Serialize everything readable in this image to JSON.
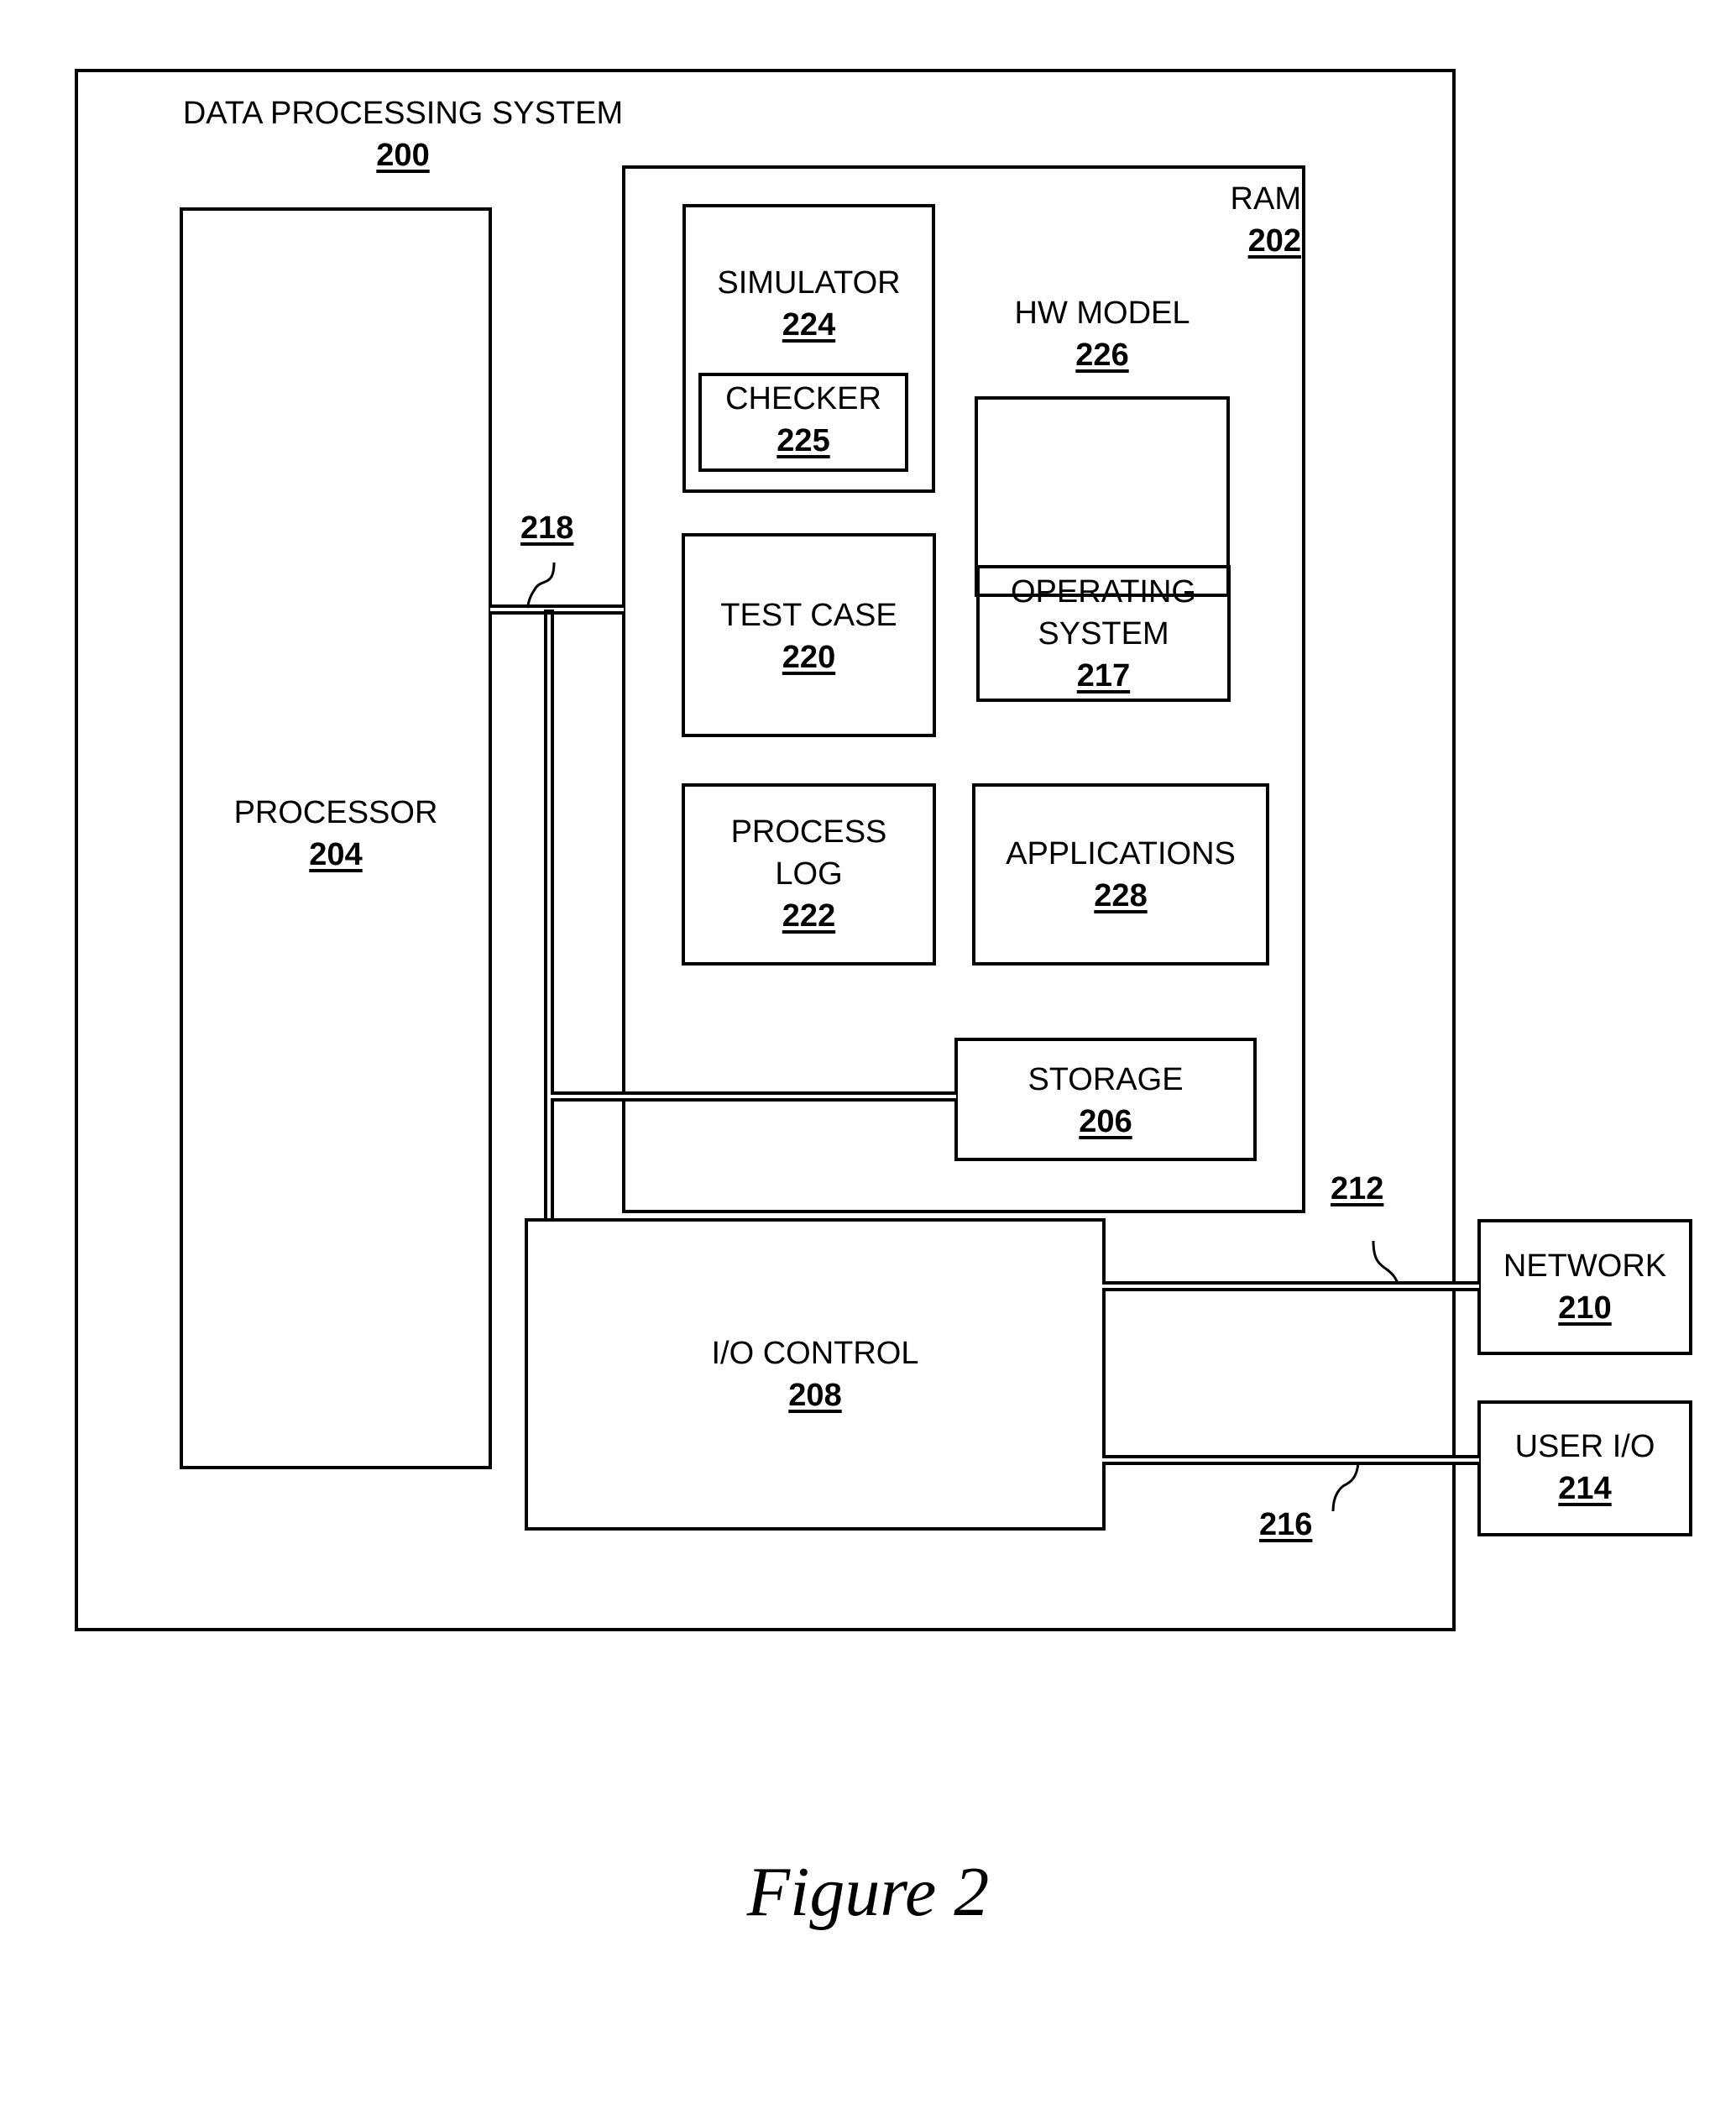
{
  "system": {
    "title": "DATA PROCESSING SYSTEM",
    "ref": "200"
  },
  "ram": {
    "title": "RAM",
    "ref": "202"
  },
  "processor": {
    "title": "PROCESSOR",
    "ref": "204"
  },
  "storage": {
    "title": "STORAGE",
    "ref": "206"
  },
  "io_control": {
    "title": "I/O CONTROL",
    "ref": "208"
  },
  "network": {
    "title": "NETWORK",
    "ref": "210"
  },
  "user_io": {
    "title": "USER I/O",
    "ref": "214"
  },
  "simulator": {
    "title": "SIMULATOR",
    "ref": "224"
  },
  "checker": {
    "title": "CHECKER",
    "ref": "225"
  },
  "hw_model": {
    "title": "HW MODEL",
    "ref": "226"
  },
  "test_case": {
    "title": "TEST CASE",
    "ref": "220"
  },
  "operating_system": {
    "title_line1": "OPERATING",
    "title_line2": "SYSTEM",
    "ref": "217"
  },
  "process_log": {
    "title_line1": "PROCESS",
    "title_line2": "LOG",
    "ref": "222"
  },
  "applications": {
    "title": "APPLICATIONS",
    "ref": "228"
  },
  "connections": {
    "bus": "218",
    "network_link": "212",
    "user_io_link": "216"
  },
  "caption": "Figure 2"
}
